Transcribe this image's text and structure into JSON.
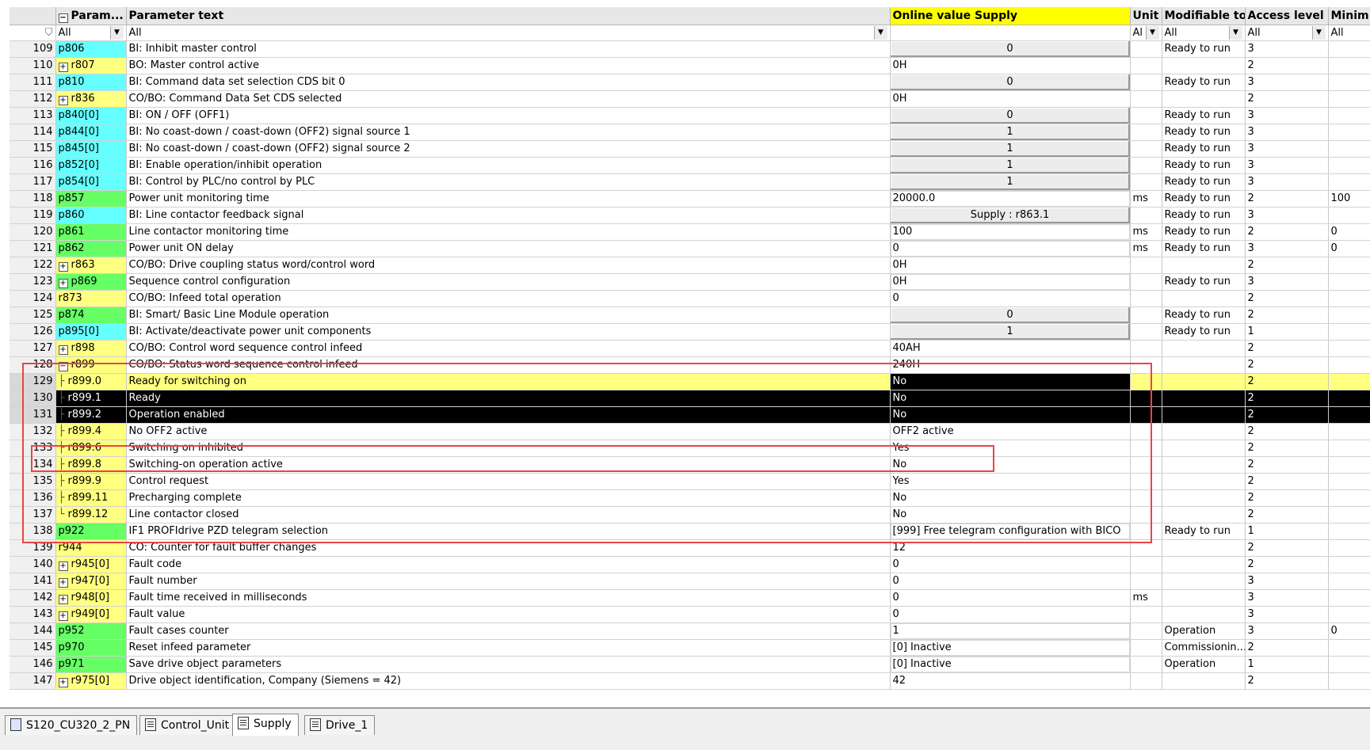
{
  "table": {
    "columns": {
      "num": "",
      "param": "Param...",
      "text": "Parameter text",
      "online": "Online value Supply",
      "unit": "Unit",
      "modifiable": "Modifiable to",
      "access": "Access level",
      "min": "Minim"
    },
    "filters": {
      "param": "All",
      "text": "All",
      "unit": "Al",
      "modifiable": "All",
      "access": "All",
      "min": "All"
    },
    "rows": [
      {
        "num": "109",
        "param": "p806",
        "ptype": "cyan",
        "text": "BI: Inhibit master control",
        "online": "0",
        "vstyle": "btn",
        "unit": "",
        "mod": "Ready to run",
        "access": "3",
        "min": ""
      },
      {
        "num": "110",
        "param": "r807",
        "ptype": "yellow",
        "exp": "+",
        "text": "BO: Master control active",
        "online": "0H",
        "vstyle": "",
        "unit": "",
        "mod": "",
        "access": "2",
        "min": ""
      },
      {
        "num": "111",
        "param": "p810",
        "ptype": "cyan",
        "text": "BI: Command data set selection CDS bit 0",
        "online": "0",
        "vstyle": "btn",
        "unit": "",
        "mod": "Ready to run",
        "access": "3",
        "min": ""
      },
      {
        "num": "112",
        "param": "r836",
        "ptype": "yellow",
        "exp": "+",
        "text": "CO/BO: Command Data Set CDS selected",
        "online": "0H",
        "vstyle": "",
        "unit": "",
        "mod": "",
        "access": "2",
        "min": ""
      },
      {
        "num": "113",
        "param": "p840[0]",
        "ptype": "cyan",
        "text": "BI: ON / OFF (OFF1)",
        "online": "0",
        "vstyle": "btn",
        "unit": "",
        "mod": "Ready to run",
        "access": "3",
        "min": ""
      },
      {
        "num": "114",
        "param": "p844[0]",
        "ptype": "cyan",
        "text": "BI: No coast-down / coast-down (OFF2) signal source 1",
        "online": "1",
        "vstyle": "btn",
        "unit": "",
        "mod": "Ready to run",
        "access": "3",
        "min": ""
      },
      {
        "num": "115",
        "param": "p845[0]",
        "ptype": "cyan",
        "text": "BI: No coast-down / coast-down (OFF2) signal source 2",
        "online": "1",
        "vstyle": "btn",
        "unit": "",
        "mod": "Ready to run",
        "access": "3",
        "min": ""
      },
      {
        "num": "116",
        "param": "p852[0]",
        "ptype": "cyan",
        "text": "BI: Enable operation/inhibit operation",
        "online": "1",
        "vstyle": "btn",
        "unit": "",
        "mod": "Ready to run",
        "access": "3",
        "min": ""
      },
      {
        "num": "117",
        "param": "p854[0]",
        "ptype": "cyan",
        "text": "BI: Control by PLC/no control by PLC",
        "online": "1",
        "vstyle": "btn",
        "unit": "",
        "mod": "Ready to run",
        "access": "3",
        "min": ""
      },
      {
        "num": "118",
        "param": "p857",
        "ptype": "green",
        "text": "Power unit monitoring time",
        "online": "20000.0",
        "vstyle": "editable",
        "unit": "ms",
        "mod": "Ready to run",
        "access": "2",
        "min": "100"
      },
      {
        "num": "119",
        "param": "p860",
        "ptype": "cyan",
        "text": "BI: Line contactor feedback signal",
        "online": "Supply : r863.1",
        "vstyle": "btn",
        "unit": "",
        "mod": "Ready to run",
        "access": "3",
        "min": ""
      },
      {
        "num": "120",
        "param": "p861",
        "ptype": "green",
        "text": "Line contactor monitoring time",
        "online": "100",
        "vstyle": "editable",
        "unit": "ms",
        "mod": "Ready to run",
        "access": "2",
        "min": "0"
      },
      {
        "num": "121",
        "param": "p862",
        "ptype": "green",
        "text": "Power unit ON delay",
        "online": "0",
        "vstyle": "editable",
        "unit": "ms",
        "mod": "Ready to run",
        "access": "3",
        "min": "0"
      },
      {
        "num": "122",
        "param": "r863",
        "ptype": "yellow",
        "exp": "+",
        "text": "CO/BO: Drive coupling status word/control word",
        "online": "0H",
        "vstyle": "",
        "unit": "",
        "mod": "",
        "access": "2",
        "min": ""
      },
      {
        "num": "123",
        "param": "p869",
        "ptype": "green",
        "exp": "+",
        "text": "Sequence control configuration",
        "online": "0H",
        "vstyle": "editable",
        "unit": "",
        "mod": "Ready to run",
        "access": "3",
        "min": ""
      },
      {
        "num": "124",
        "param": "r873",
        "ptype": "yellow",
        "text": "CO/BO: Infeed total operation",
        "online": "0",
        "vstyle": "",
        "unit": "",
        "mod": "",
        "access": "2",
        "min": ""
      },
      {
        "num": "125",
        "param": "p874",
        "ptype": "green",
        "text": "BI: Smart/ Basic Line Module operation",
        "online": "0",
        "vstyle": "btn",
        "unit": "",
        "mod": "Ready to run",
        "access": "2",
        "min": ""
      },
      {
        "num": "126",
        "param": "p895[0]",
        "ptype": "cyan",
        "text": "BI: Activate/deactivate power unit components",
        "online": "1",
        "vstyle": "btn",
        "unit": "",
        "mod": "Ready to run",
        "access": "1",
        "min": ""
      },
      {
        "num": "127",
        "param": "r898",
        "ptype": "yellow",
        "exp": "+",
        "text": "CO/BO: Control word sequence control infeed",
        "online": "40AH",
        "vstyle": "",
        "unit": "",
        "mod": "",
        "access": "2",
        "min": ""
      },
      {
        "num": "128",
        "param": "r899",
        "ptype": "yellow",
        "exp": "-",
        "text": "CO/BO: Status word sequence control infeed",
        "online": "240H",
        "vstyle": "",
        "unit": "",
        "mod": "",
        "access": "2",
        "min": ""
      },
      {
        "num": "129",
        "param": "r899.0",
        "ptype": "child",
        "tree": "├",
        "text": "Ready for switching on",
        "online": "No",
        "vstyle": "",
        "unit": "",
        "mod": "",
        "access": "2",
        "min": "",
        "sel": "yellow"
      },
      {
        "num": "130",
        "param": "r899.1",
        "ptype": "child",
        "tree": "├",
        "text": "Ready",
        "online": "No",
        "vstyle": "",
        "unit": "",
        "mod": "",
        "access": "2",
        "min": "",
        "sel": "black"
      },
      {
        "num": "131",
        "param": "r899.2",
        "ptype": "child",
        "tree": "├",
        "text": "Operation enabled",
        "online": "No",
        "vstyle": "",
        "unit": "",
        "mod": "",
        "access": "2",
        "min": "",
        "sel": "black"
      },
      {
        "num": "132",
        "param": "r899.4",
        "ptype": "child",
        "tree": "├",
        "text": "No OFF2 active",
        "online": "OFF2 active",
        "vstyle": "",
        "unit": "",
        "mod": "",
        "access": "2",
        "min": ""
      },
      {
        "num": "133",
        "param": "r899.6",
        "ptype": "child",
        "tree": "├",
        "text": "Switching on inhibited",
        "online": "Yes",
        "vstyle": "",
        "unit": "",
        "mod": "",
        "access": "2",
        "min": ""
      },
      {
        "num": "134",
        "param": "r899.8",
        "ptype": "child",
        "tree": "├",
        "text": "Switching-on operation active",
        "online": "No",
        "vstyle": "",
        "unit": "",
        "mod": "",
        "access": "2",
        "min": ""
      },
      {
        "num": "135",
        "param": "r899.9",
        "ptype": "child",
        "tree": "├",
        "text": "Control request",
        "online": "Yes",
        "vstyle": "",
        "unit": "",
        "mod": "",
        "access": "2",
        "min": ""
      },
      {
        "num": "136",
        "param": "r899.11",
        "ptype": "child",
        "tree": "├",
        "text": "Precharging complete",
        "online": "No",
        "vstyle": "",
        "unit": "",
        "mod": "",
        "access": "2",
        "min": ""
      },
      {
        "num": "137",
        "param": "r899.12",
        "ptype": "child",
        "tree": "└",
        "text": "Line contactor closed",
        "online": "No",
        "vstyle": "",
        "unit": "",
        "mod": "",
        "access": "2",
        "min": ""
      },
      {
        "num": "138",
        "param": "p922",
        "ptype": "green",
        "text": "IF1 PROFIdrive PZD telegram selection",
        "online": "[999] Free telegram configuration with BICO",
        "vstyle": "editable",
        "unit": "",
        "mod": "Ready to run",
        "access": "1",
        "min": ""
      },
      {
        "num": "139",
        "param": "r944",
        "ptype": "yellow",
        "text": "CO: Counter for fault buffer changes",
        "online": "12",
        "vstyle": "",
        "unit": "",
        "mod": "",
        "access": "2",
        "min": ""
      },
      {
        "num": "140",
        "param": "r945[0]",
        "ptype": "yellow",
        "exp": "+",
        "text": "Fault code",
        "online": "0",
        "vstyle": "",
        "unit": "",
        "mod": "",
        "access": "2",
        "min": ""
      },
      {
        "num": "141",
        "param": "r947[0]",
        "ptype": "yellow",
        "exp": "+",
        "text": "Fault number",
        "online": "0",
        "vstyle": "",
        "unit": "",
        "mod": "",
        "access": "3",
        "min": ""
      },
      {
        "num": "142",
        "param": "r948[0]",
        "ptype": "yellow",
        "exp": "+",
        "text": "Fault time received in milliseconds",
        "online": "0",
        "vstyle": "",
        "unit": "ms",
        "mod": "",
        "access": "3",
        "min": ""
      },
      {
        "num": "143",
        "param": "r949[0]",
        "ptype": "yellow",
        "exp": "+",
        "text": "Fault value",
        "online": "0",
        "vstyle": "",
        "unit": "",
        "mod": "",
        "access": "3",
        "min": ""
      },
      {
        "num": "144",
        "param": "p952",
        "ptype": "green",
        "text": "Fault cases counter",
        "online": "1",
        "vstyle": "editable",
        "unit": "",
        "mod": "Operation",
        "access": "3",
        "min": "0"
      },
      {
        "num": "145",
        "param": "p970",
        "ptype": "green",
        "text": "Reset infeed parameter",
        "online": "[0] Inactive",
        "vstyle": "editable",
        "unit": "",
        "mod": "Commissionin...",
        "access": "2",
        "min": ""
      },
      {
        "num": "146",
        "param": "p971",
        "ptype": "green",
        "text": "Save drive object parameters",
        "online": "[0] Inactive",
        "vstyle": "editable",
        "unit": "",
        "mod": "Operation",
        "access": "1",
        "min": ""
      },
      {
        "num": "147",
        "param": "r975[0]",
        "ptype": "yellow",
        "exp": "+",
        "text": "Drive object identification, Company (Siemens = 42)",
        "online": "42",
        "vstyle": "",
        "unit": "",
        "mod": "",
        "access": "2",
        "min": ""
      }
    ]
  },
  "tabs": [
    {
      "label": "S120_CU320_2_PN",
      "icon": "device-icon"
    },
    {
      "label": "Control_Unit",
      "icon": "list-icon"
    },
    {
      "label": "Supply",
      "icon": "list-icon",
      "active": true
    },
    {
      "label": "Drive_1",
      "icon": "list-icon"
    }
  ],
  "colors": {
    "online_header": "#ffff00",
    "param_green": "#66ff66",
    "param_cyan": "#66ffff",
    "param_yellow": "#ffff80",
    "highlight_box": "#e84545"
  }
}
